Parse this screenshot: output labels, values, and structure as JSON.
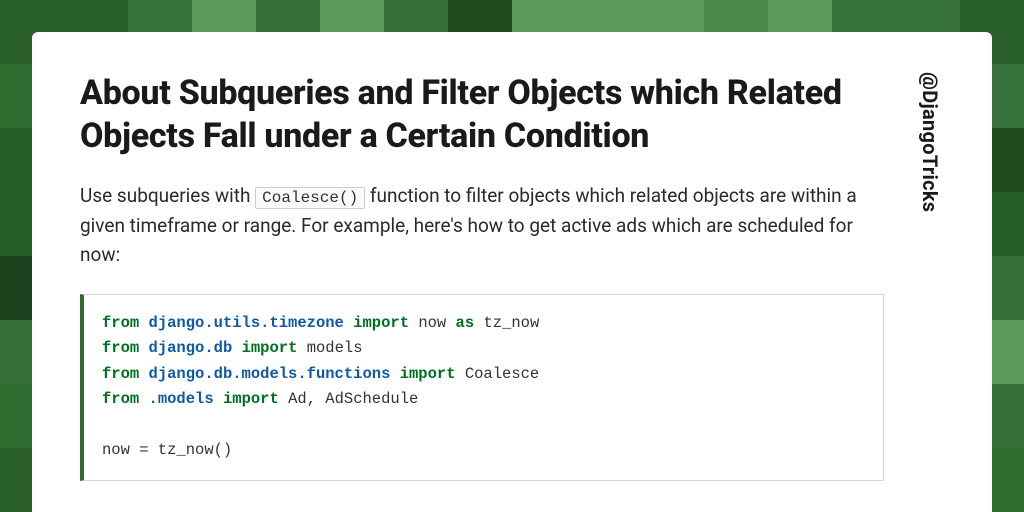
{
  "title": "About Subqueries and Filter Objects which Related Objects Fall under a Certain Condition",
  "handle": "@DjangoTricks",
  "desc_parts": {
    "a": "Use subqueries with ",
    "inline_code": "Coalesce()",
    "b": " function to filter objects which related objects are within a given timeframe or range. For example, here's how to get active ads which are scheduled for now:"
  },
  "code": {
    "kw_from": "from",
    "kw_import": "import",
    "kw_as": "as",
    "l1_mod": "django.utils.timezone",
    "l1_name": "now",
    "l1_alias": "tz_now",
    "l2_mod": "django.db",
    "l2_name": "models",
    "l3_mod": "django.db.models.functions",
    "l3_name": "Coalesce",
    "l4_mod": ".models",
    "l4_name": "Ad, AdSchedule",
    "l6": "now = tz_now()"
  },
  "bg_colors": [
    "#1f4d1f",
    "#2e6b2e",
    "#3d7a3d",
    "#4c8a4c",
    "#265f26",
    "#356f35",
    "#1a421a",
    "#5a9a5a",
    "#2a612a",
    "#37733a"
  ]
}
